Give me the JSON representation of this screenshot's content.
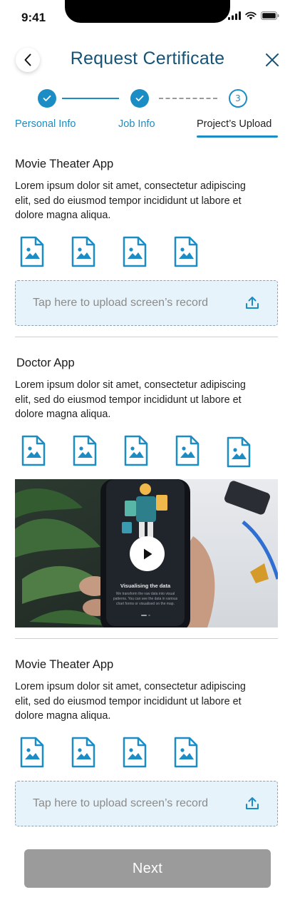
{
  "status_bar": {
    "time": "9:41"
  },
  "header": {
    "title": "Request Certificate"
  },
  "stepper": {
    "step3_number": "3"
  },
  "tabs": [
    {
      "label": "Personal Info"
    },
    {
      "label": "Job Info"
    },
    {
      "label": "Project’s Upload"
    }
  ],
  "projects": [
    {
      "title": "Movie Theater App",
      "description": [
        "Lorem ipsum dolor sit amet, consectetur adipiscing",
        "elit, sed do eiusmod tempor incididunt ut labore et",
        "dolore magna aliqua."
      ],
      "upload_label": "Tap here to upload screen’s record"
    },
    {
      "title": "Doctor App",
      "description": [
        "Lorem ipsum dolor sit amet, consectetur adipiscing",
        "elit, sed do eiusmod tempor incididunt ut labore et",
        "dolore magna aliqua."
      ],
      "video": {
        "screen_heading": "Visualising the data",
        "screen_text": [
          "We transform the raw data into visual",
          "patterns. You can see the data in various",
          "chart forms or visualised on the map."
        ]
      }
    },
    {
      "title": "Movie Theater App",
      "description": [
        "Lorem ipsum dolor sit amet, consectetur adipiscing",
        "elit, sed do eiusmod tempor incididunt ut labore et",
        "dolore magna aliqua."
      ],
      "upload_label": "Tap here to upload screen’s record"
    }
  ],
  "footer": {
    "next_label": "Next"
  },
  "colors": {
    "accent": "#1b8dc4",
    "title": "#155377",
    "disabled_button": "#9b9b9b",
    "upload_bg": "#e7f3fa"
  }
}
